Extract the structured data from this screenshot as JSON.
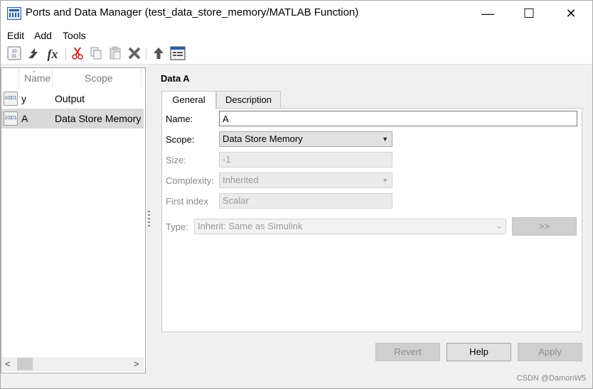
{
  "window": {
    "title": "Ports and Data Manager (test_data_store_memory/MATLAB Function)",
    "minimize_glyph": "—",
    "maximize_glyph": "☐",
    "close_glyph": "✕"
  },
  "menubar": {
    "items": [
      "Edit",
      "Add",
      "Tools"
    ]
  },
  "toolbar": {
    "icons": [
      "add-data-icon",
      "add-input-icon",
      "add-function-icon",
      "cut-icon",
      "copy-icon",
      "paste-icon",
      "delete-icon",
      "go-to-parent-icon",
      "model-explorer-icon"
    ]
  },
  "left_panel": {
    "columns": [
      "Name",
      "Scope"
    ],
    "rows": [
      {
        "name": "y",
        "scope": "Output",
        "selected": false
      },
      {
        "name": "A",
        "scope": "Data Store Memory",
        "selected": true
      }
    ],
    "row_icon_text": "10|01",
    "scroll_left": "<",
    "scroll_right": ">"
  },
  "details": {
    "title": "Data A",
    "tabs": [
      "General",
      "Description"
    ],
    "active_tab": "General",
    "fields": {
      "name_label": "Name:",
      "name_value": "A",
      "scope_label": "Scope:",
      "scope_value": "Data Store Memory",
      "size_label": "Size:",
      "size_value": "-1",
      "complexity_label": "Complexity:",
      "complexity_value": "Inherited",
      "first_index_label": "First index",
      "first_index_value": "Scalar",
      "type_label": "Type:",
      "type_value": "Inherit: Same as Simulink"
    },
    "type_button": ">>",
    "dropdown_caret": "▼"
  },
  "footer": {
    "revert": "Revert",
    "help": "Help",
    "apply": "Apply"
  },
  "watermark": "CSDN @DamonW5",
  "colors": {
    "selected_row": "#d9d9d9",
    "disabled_text": "#8a8a8a",
    "border": "#a8a8a8"
  }
}
